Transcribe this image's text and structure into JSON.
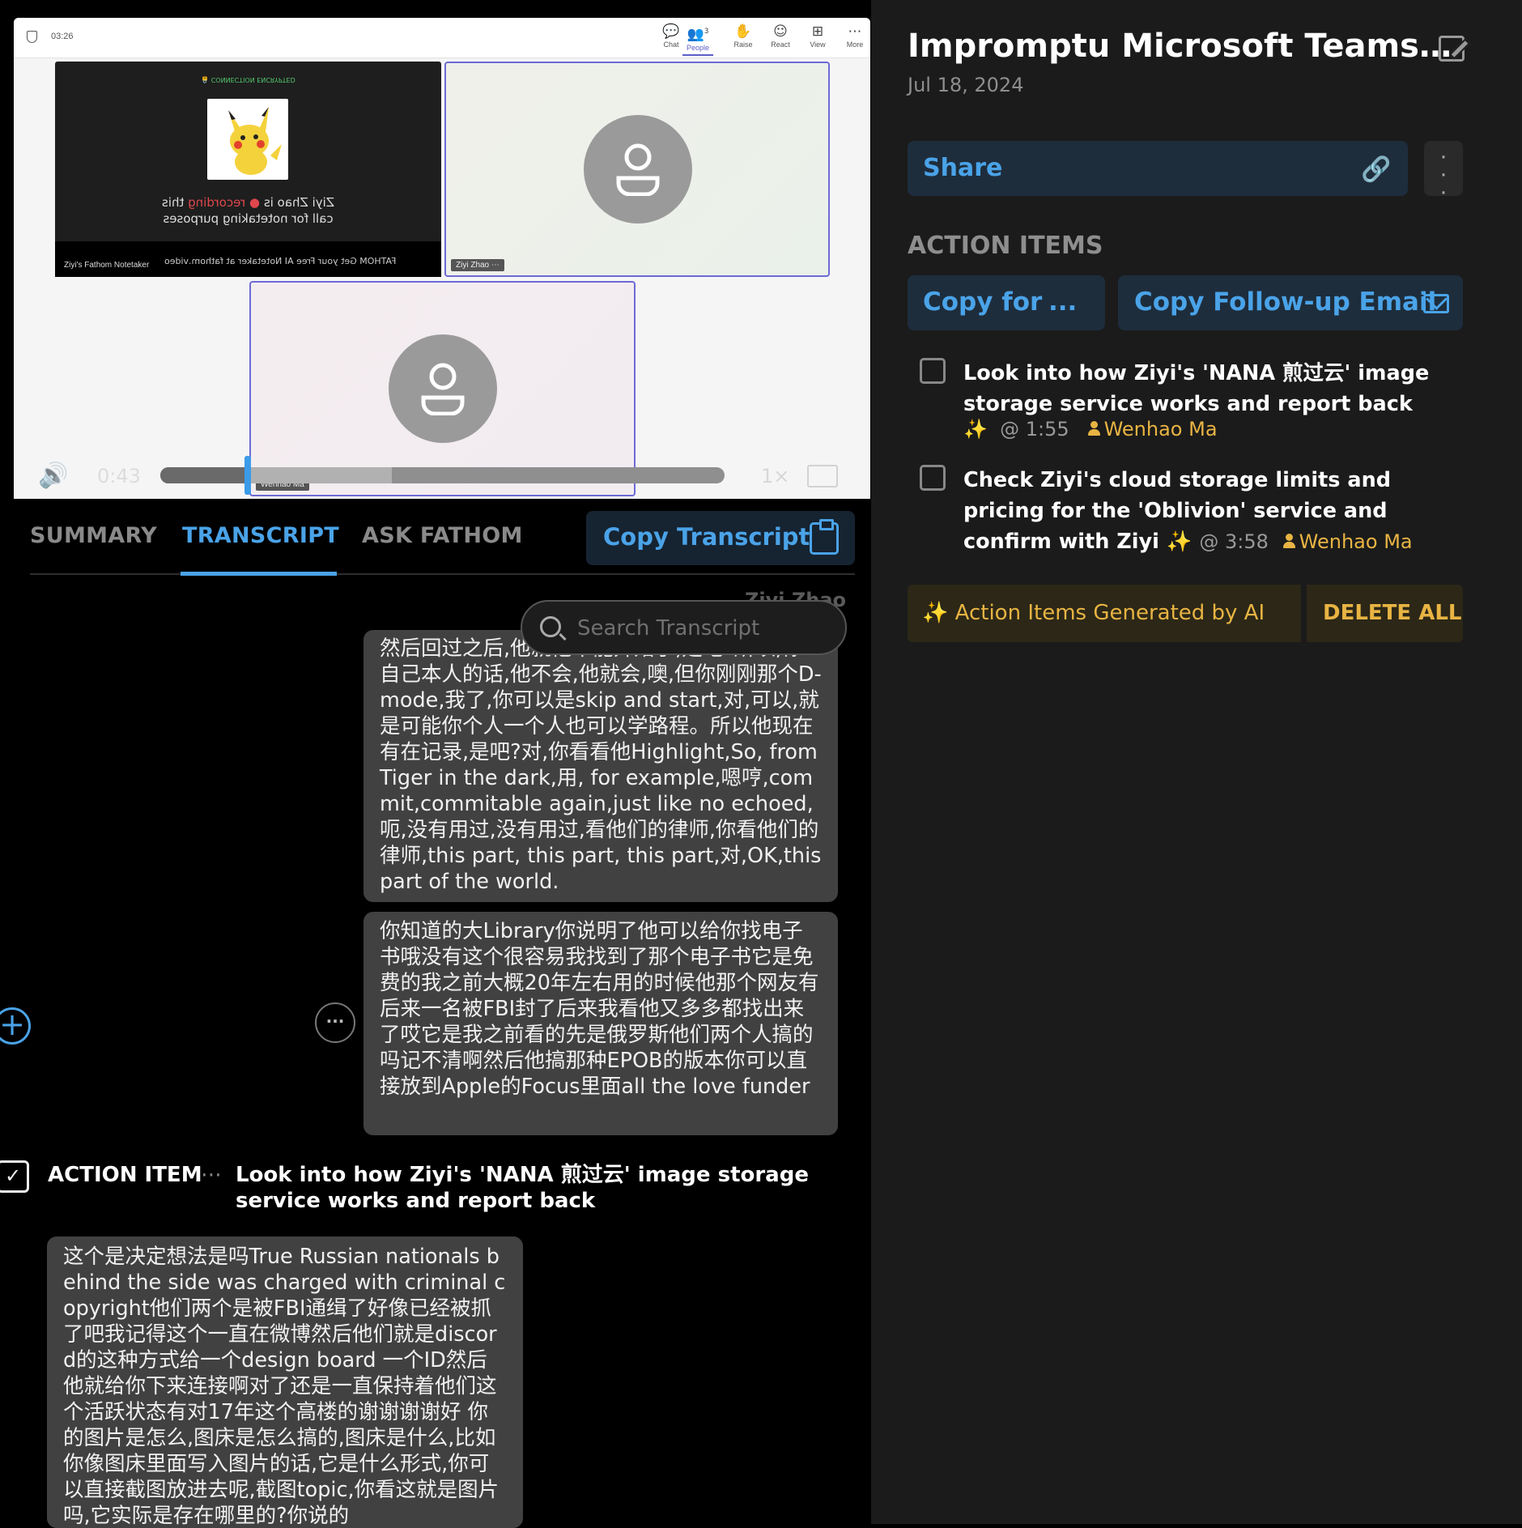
{
  "video": {
    "meeting_clock": "03:26",
    "toolbar": [
      {
        "id": "chat",
        "label": "Chat",
        "icon": "chat-icon",
        "glyph": "💬"
      },
      {
        "id": "people",
        "label": "People",
        "icon": "people-icon",
        "glyph": "👥",
        "badge": "3"
      },
      {
        "id": "raise",
        "label": "Raise",
        "icon": "raise-hand-icon",
        "glyph": "✋"
      },
      {
        "id": "react",
        "label": "React",
        "icon": "react-icon",
        "glyph": "☺"
      },
      {
        "id": "view",
        "label": "View",
        "icon": "view-grid-icon",
        "glyph": "⊞"
      },
      {
        "id": "more",
        "label": "More",
        "icon": "more-icon",
        "glyph": "⋯"
      }
    ],
    "fathom_tile": {
      "encrypted": "🔒 CONNECTION ENCRYPTED",
      "recording_line1_pre": "Ziyi Zhao is ",
      "recording_word": "● recording",
      "recording_line1_post": " this",
      "recording_line2": "call for notetaking purposes",
      "name": "Ziyi's Fathom Notetaker",
      "ad": "FATHOM  Get your Free AI Notetaker at fathom.video"
    },
    "ziyi_name": "Ziyi Zhao ⋯",
    "wenhao_name": "Wenhao Ma",
    "current_time": "0:43",
    "speed": "1×",
    "progress_fraction": 0.155,
    "buffered_fraction": 0.41
  },
  "tabs": {
    "summary": "SUMMARY",
    "transcript": "TRANSCRIPT",
    "ask": "ASK FATHOM",
    "copy_transcript": "Copy Transcript"
  },
  "transcript": {
    "ghost_speaker": "Ziyi Zhao",
    "search_placeholder": "Search Transcript",
    "bubble1": "然后回过之后,他就他不能开始了,是吧?所以,你自己本人的话,他不会,他就会,噢,但你刚刚那个D-mode,我了,你可以是skip and start,对,可以,就是可能你个人一个人也可以学路程。所以他现在有在记录,是吧?对,你看看他Highlight,So, from Tiger in the dark,用, for example,嗯哼,commit,commitable again,just like no echoed,呃,没有用过,没有用过,看他们的律师,你看他们的律师,this part, this part, this part,对,OK,this part of the world.",
    "bubble2": "你知道的大Library你说明了他可以给你找电子书哦没有这个很容易我找到了那个电子书它是免费的我之前大概20年左右用的时候他那个网友有后来一名被FBI封了后来我看他又多多都找出来了哎它是我之前看的先是俄罗斯他们两个人搞的吗记不清啊然后他搞那种EPOB的版本你可以直接放到Apple的Focus里面all the love funder",
    "bubble3": "这个是决定想法是吗True Russian nationals behind the side was charged with criminal copyright他们两个是被FBI通缉了好像已经被抓了吧我记得这个一直在微博然后他们就是discord的这种方式给一个design board 一个ID然后他就给你下来连接啊对了还是一直保持着他们这个活跃状态有对17年这个高楼的谢谢谢谢好 你的图片是怎么,图床是怎么搞的,图床是什么,比如你像图床里面写入图片的话,它是什么形式,你可以直接截图放进去呢,截图topic,你看这就是图片吗,它实际是存在哪里的?你说的",
    "action_tag": "ACTION ITEM",
    "action_dots": "⋯",
    "action_text": "Look into how Ziyi's 'NANA 煎过云' image storage service works and report back"
  },
  "panel": {
    "title": "Impromptu Microsoft Teams M...",
    "date": "Jul 18, 2024",
    "share": "Share",
    "action_items_heading": "ACTION ITEMS",
    "copy_for": "Copy for",
    "copy_for_more": "...",
    "copy_email": "Copy Follow-up Email",
    "items": [
      {
        "text": "Look into how Ziyi's 'NANA 煎过云' image storage service works and report back",
        "sparkle": "✨",
        "time": "@ 1:55",
        "assignee": "Wenhao Ma"
      },
      {
        "text": "Check Ziyi's cloud storage limits and pricing for the 'Oblivion' service and confirm with Ziyi",
        "sparkle": "✨",
        "time": "@ 3:58",
        "assignee": "Wenhao Ma"
      }
    ],
    "ai_banner": "✨  Action Items Generated by AI",
    "delete_all": "DELETE ALL"
  },
  "colors": {
    "accent": "#4aa3e8",
    "gold": "#e8b443",
    "teams_purple": "#5b5fc7"
  }
}
